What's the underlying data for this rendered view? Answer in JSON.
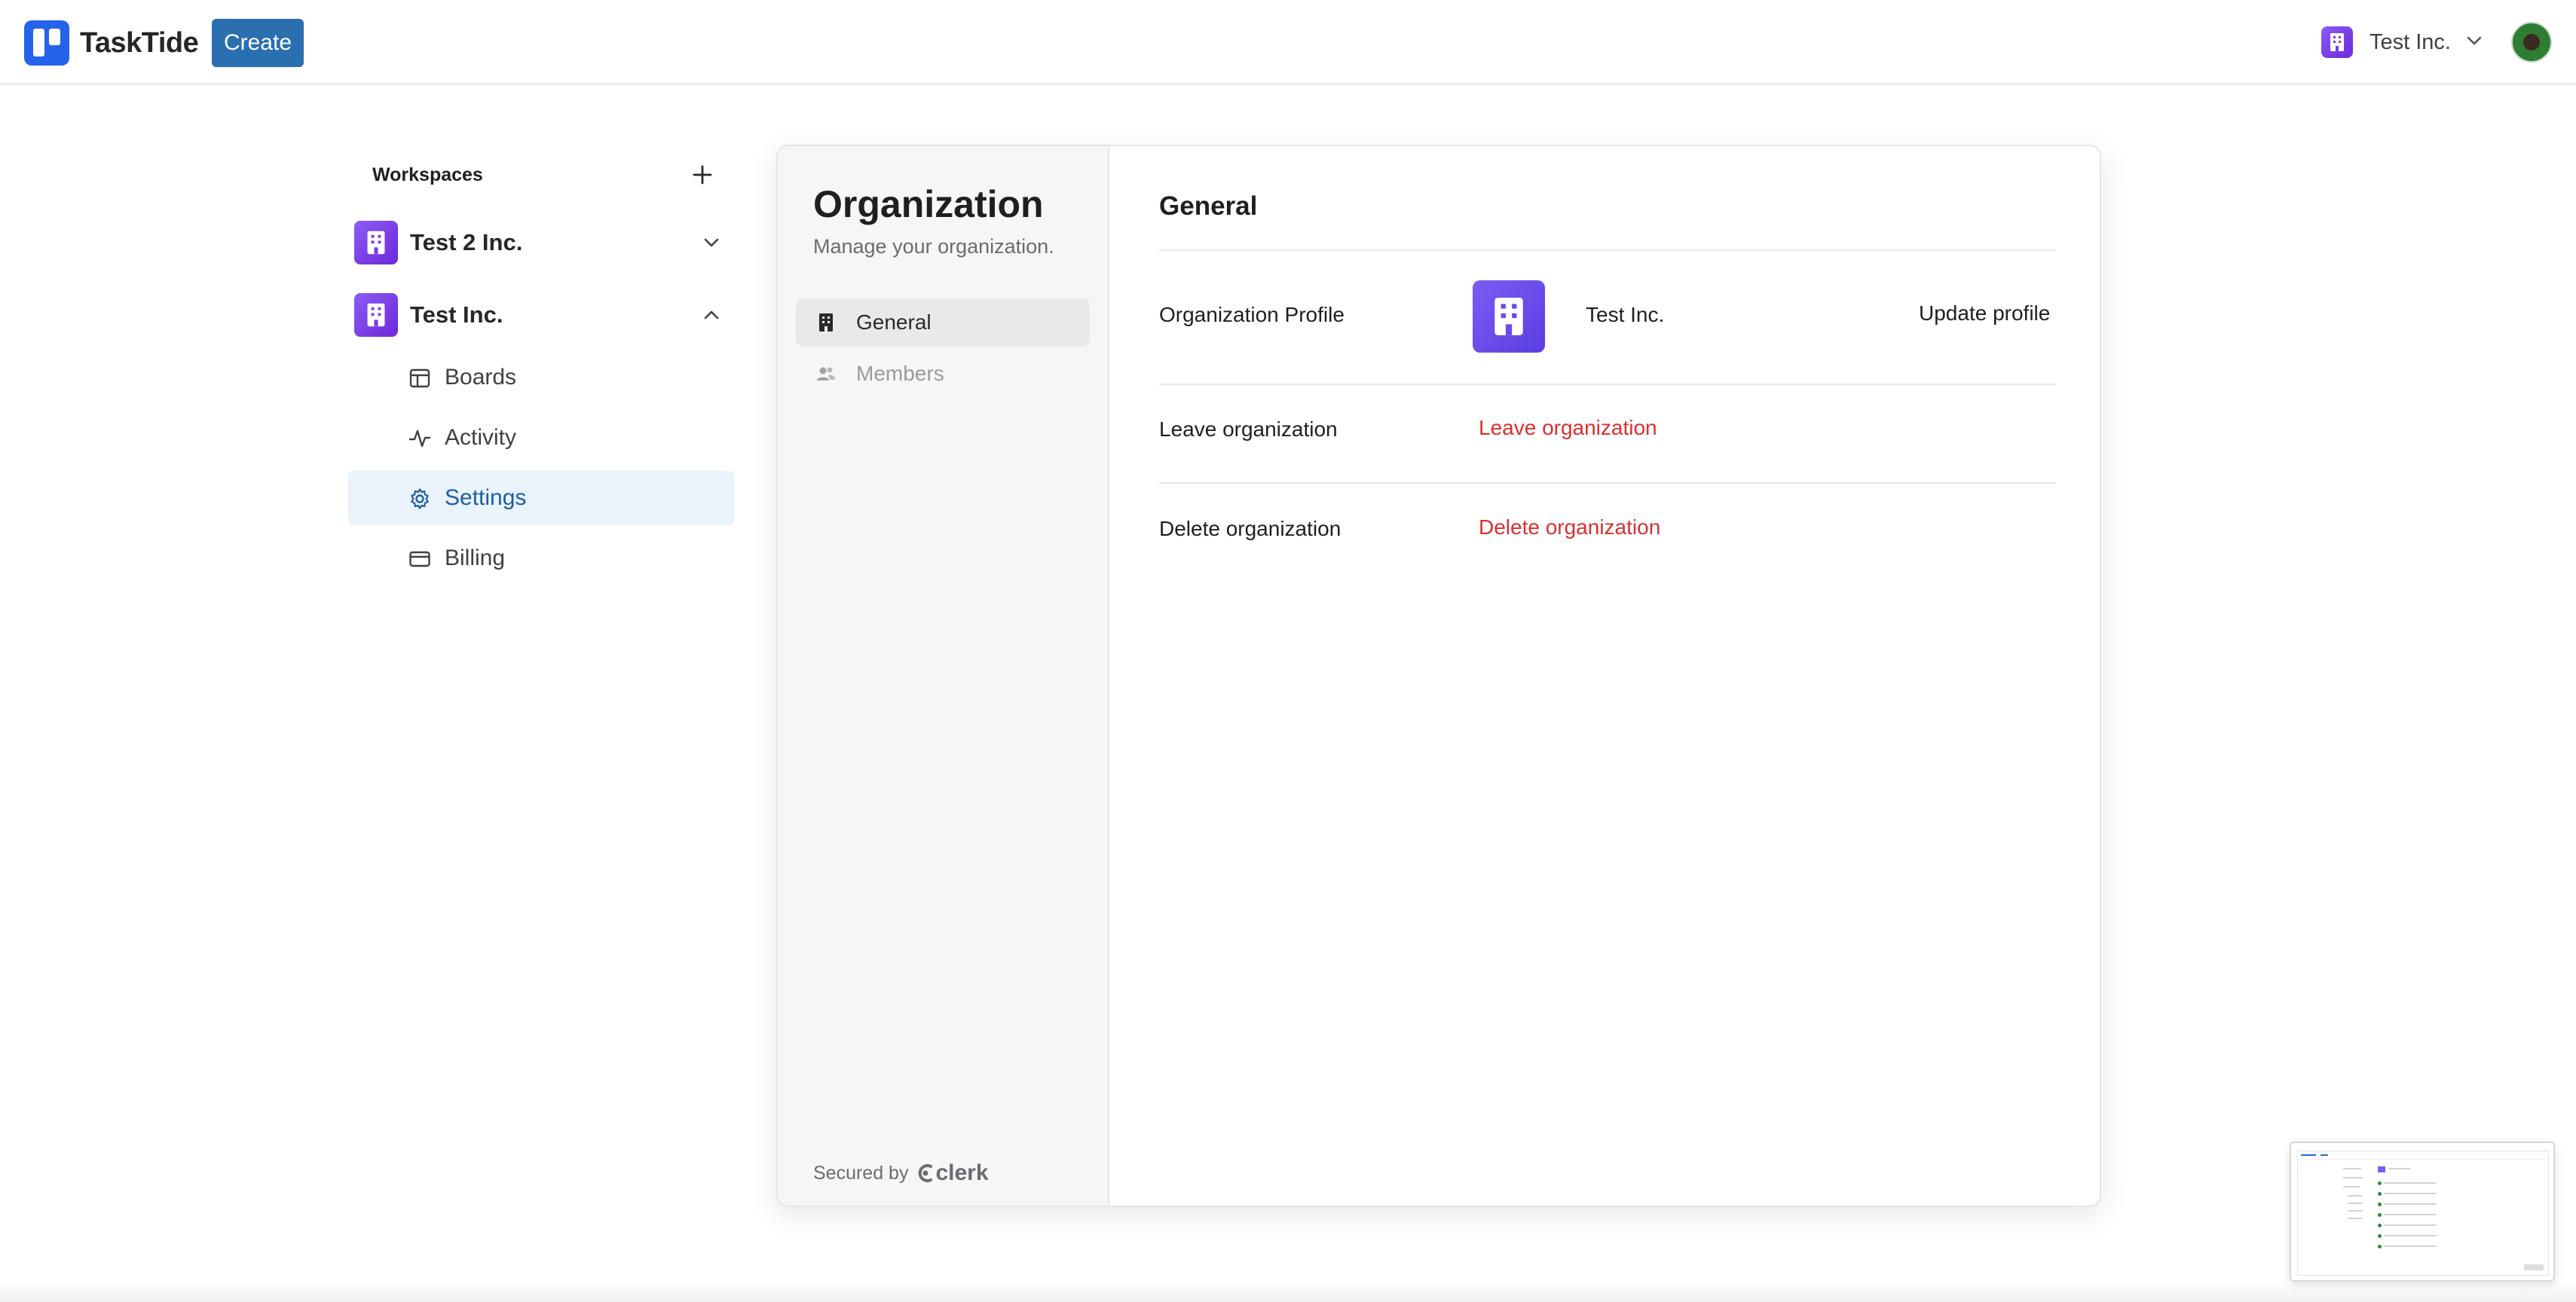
{
  "navbar": {
    "app_name": "TaskTide",
    "create_label": "Create",
    "org_switcher": {
      "name": "Test Inc."
    }
  },
  "sidebar": {
    "header": "Workspaces",
    "workspaces": [
      {
        "name": "Test 2 Inc.",
        "expanded": false
      },
      {
        "name": "Test Inc.",
        "expanded": true
      }
    ],
    "items": [
      {
        "label": "Boards",
        "icon": "layout-icon"
      },
      {
        "label": "Activity",
        "icon": "activity-icon"
      },
      {
        "label": "Settings",
        "icon": "gear-icon",
        "active": true
      },
      {
        "label": "Billing",
        "icon": "credit-card-icon"
      }
    ]
  },
  "org_card": {
    "title": "Organization",
    "subtitle": "Manage your organization.",
    "tabs": [
      {
        "label": "General",
        "active": true
      },
      {
        "label": "Members",
        "active": false
      }
    ],
    "secured_by": "Secured by",
    "secured_brand": "clerk",
    "general": {
      "title": "General",
      "profile_label": "Organization Profile",
      "profile_name": "Test Inc.",
      "update_label": "Update profile",
      "leave_label": "Leave organization",
      "leave_action": "Leave organization",
      "delete_label": "Delete organization",
      "delete_action": "Delete organization"
    }
  },
  "colors": {
    "brand_blue": "#2563eb",
    "create_button": "#2a6fb0",
    "org_purple": "#7c5cf4",
    "danger": "#dc2f2f",
    "active_nav_bg": "#eaf2fb"
  }
}
